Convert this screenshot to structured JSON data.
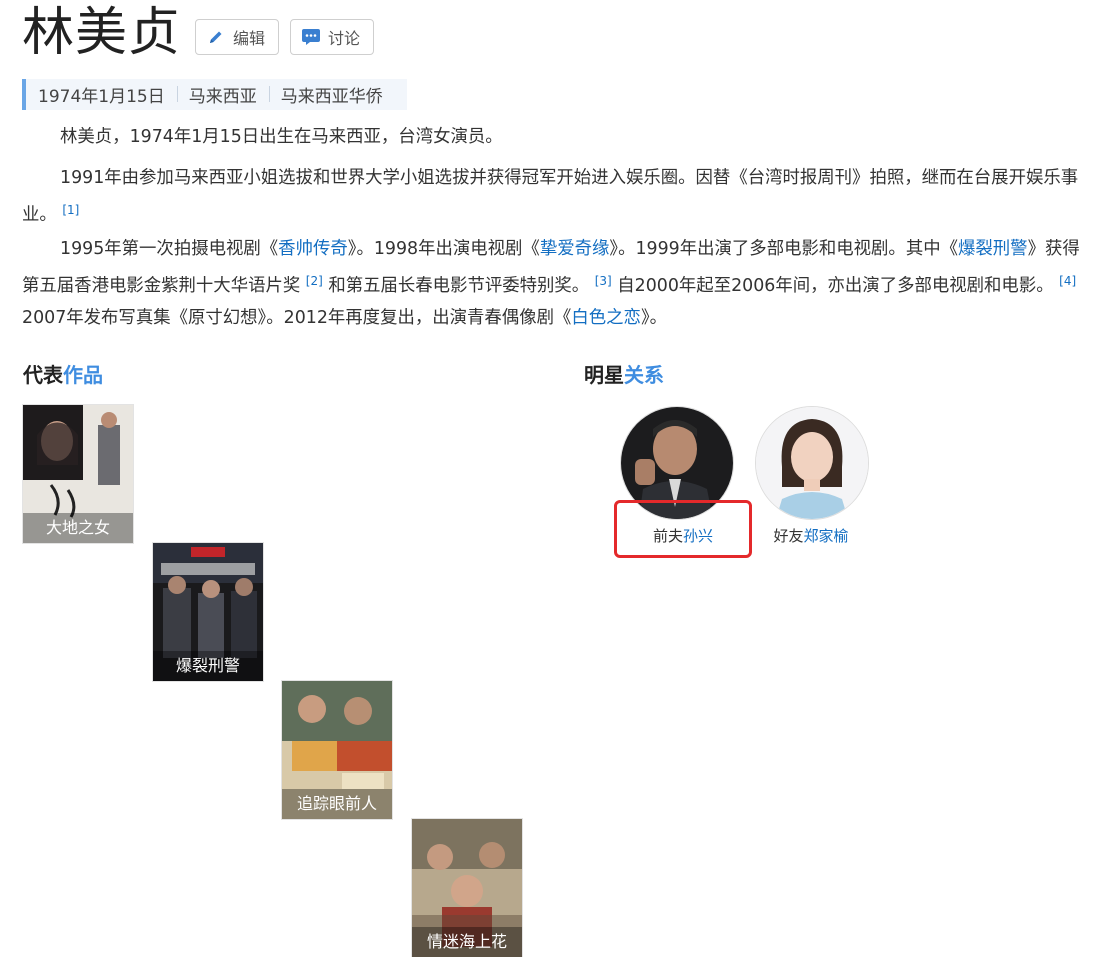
{
  "header": {
    "title": "林美贞",
    "edit_label": "编辑",
    "discuss_label": "讨论"
  },
  "info_strip": {
    "items": [
      "1974年1月15日",
      "马来西亚",
      "马来西亚华侨"
    ]
  },
  "paragraphs": {
    "p1": "林美贞，1974年1月15日出生在马来西亚，台湾女演员。",
    "p2_text": "1991年由参加马来西亚小姐选拔和世界大学小姐选拔并获得冠军开始进入娱乐圈。因替《台湾时报周刊》拍照，继而在台展开娱乐事业。",
    "p2_ref": "[1]",
    "p3": {
      "t1": "1995年第一次拍摄电视剧《",
      "l1": "香帅传奇",
      "t2": "》。1998年出演电视剧《",
      "l2": "挚爱奇缘",
      "t3": "》。1999年出演了多部电影和电视剧。其中《",
      "l3": "爆裂刑警",
      "t4": "》获得第五届香港电影金紫荆十大华语片奖",
      "r2": "[2]",
      "t5": "和第五届长春电影节评委特别奖。",
      "r3": "[3]",
      "t6": "自2000年起至2006年间，亦出演了多部电视剧和电影。",
      "r4": "[4]",
      "t7": "2007年发布写真集《原寸幻想》。2012年再度复出，出演青春偶像剧《",
      "l4": "白色之恋",
      "t8": "》。"
    }
  },
  "works": {
    "title_a": "代表",
    "title_b": "作品",
    "items": [
      {
        "caption": "大地之女"
      },
      {
        "caption": "爆裂刑警"
      },
      {
        "caption": "追踪眼前人"
      },
      {
        "caption": "情迷海上花"
      }
    ]
  },
  "relations": {
    "title_a": "明星",
    "title_b": "关系",
    "items": [
      {
        "relation": "前夫",
        "name": "孙兴"
      },
      {
        "relation": "好友",
        "name": "郑家榆"
      }
    ]
  },
  "colors": {
    "link": "#136ec2",
    "accent": "#3f8de0",
    "highlight_box": "#e4292b"
  }
}
